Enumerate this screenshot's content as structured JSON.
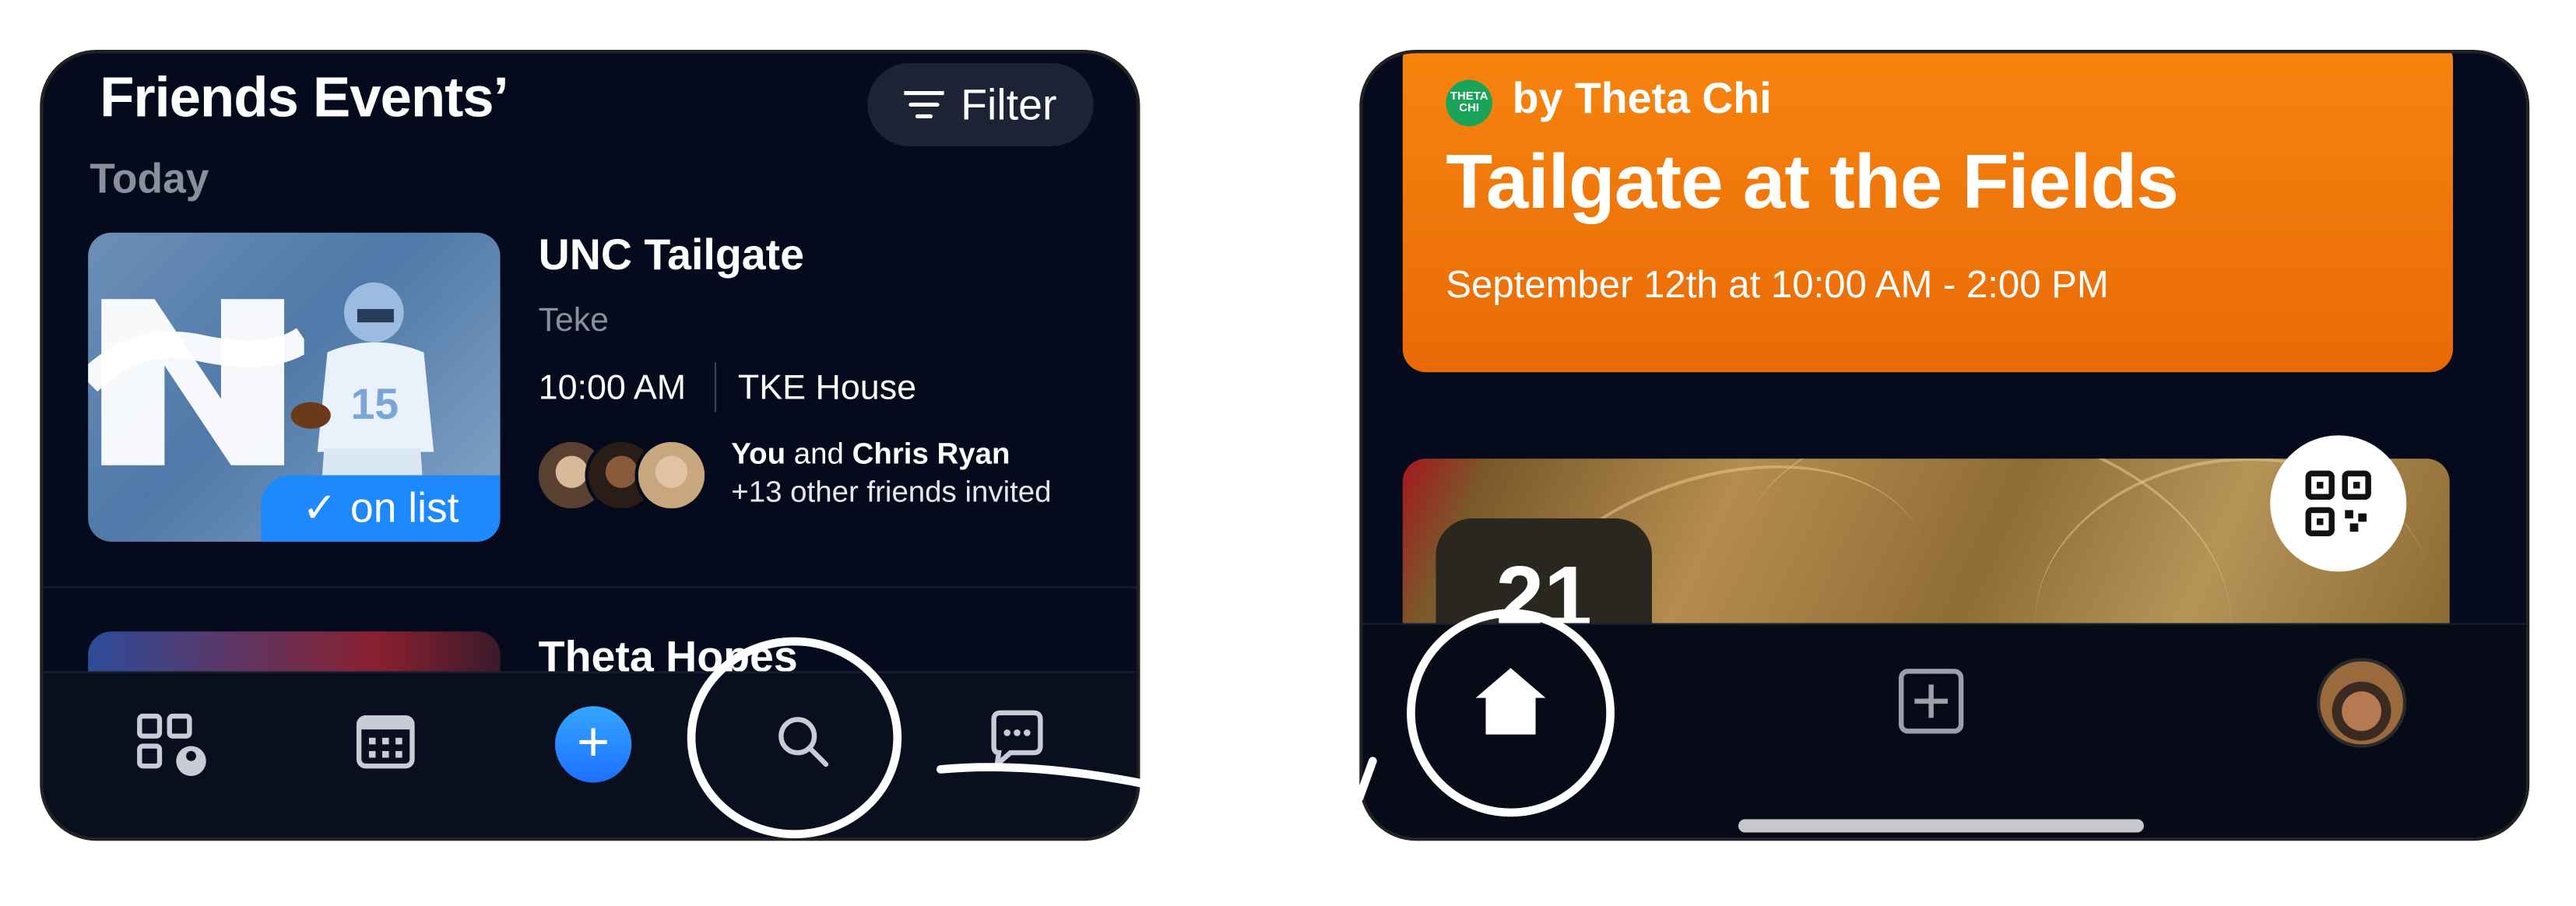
{
  "left_screen": {
    "title": "Friends Events’",
    "filter_label": "Filter",
    "section": "Today",
    "event1": {
      "title": "UNC Tailgate",
      "host": "Teke",
      "time": "10:00 AM",
      "location": "TKE House",
      "badge_check": "✓",
      "badge": "on list",
      "invite_you": "You",
      "invite_and": "and",
      "invite_name": "Chris Ryan",
      "invite_more": "+13 other friends invited"
    },
    "event2": {
      "title": "Theta Hopes"
    },
    "tabs": [
      "qr-profile",
      "calendar",
      "add",
      "search",
      "messages"
    ]
  },
  "right_screen": {
    "logo_text": "THETA CHI",
    "byline": "by Theta Chi",
    "title": "Tailgate at the Fields",
    "datetime": "September 12th at 10:00 AM - 2:00 PM",
    "date_badge": "21",
    "tabs": [
      "home",
      "add",
      "profile"
    ]
  },
  "colors": {
    "accent_blue": "#1e88ff",
    "orange": "#f7850f",
    "background": "#050a1d"
  }
}
